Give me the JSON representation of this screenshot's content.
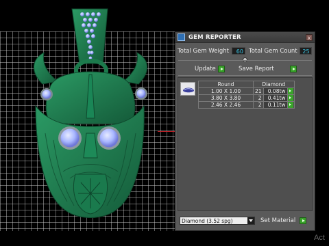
{
  "panel": {
    "title": "GEM REPORTER",
    "close_label": "x",
    "total_weight_label": "Total Gem Weight",
    "total_weight_value": "60",
    "total_count_label": "Total Gem Count",
    "total_count_value": "25",
    "update_label": "Update",
    "save_report_label": "Save Report",
    "table": {
      "col_shape": "Round",
      "col_material": "Diamond",
      "rows": [
        {
          "size": "1.00 X 1.00",
          "qty": "21",
          "weight": "0.08tw"
        },
        {
          "size": "3.80 X 3.80",
          "qty": "2",
          "weight": "0.41tw"
        },
        {
          "size": "2.46 X 2.46",
          "qty": "2",
          "weight": "0.11tw"
        }
      ]
    },
    "material_select_value": "Diamond    (3.52 spg)",
    "set_material_label": "Set Material"
  },
  "watermark": "Act",
  "colors": {
    "model_green": "#1f7a4f",
    "gem_blue": "#a9b7ff",
    "value_cyan": "#3dc9e8",
    "go_green": "#3aa32b",
    "axis_red": "#c0232a"
  }
}
